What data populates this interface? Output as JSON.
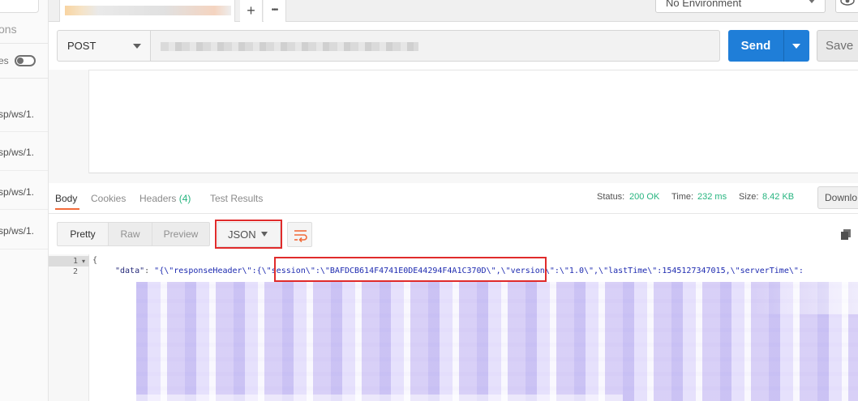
{
  "sidebar": {
    "tab_partial": "ons",
    "toggle_partial": "es",
    "items": [
      {
        "text": "sp/ws/1."
      },
      {
        "text": "sp/ws/1."
      },
      {
        "text": "sp/ws/1."
      },
      {
        "text": "sp/ws/1."
      }
    ]
  },
  "tabs": {
    "add_label": "+",
    "more_label": "•••"
  },
  "environment": {
    "selected": "No Environment",
    "eye_icon": "eye-icon"
  },
  "request": {
    "method": "POST",
    "send_label": "Send",
    "save_label": "Save"
  },
  "response": {
    "tabs": [
      {
        "label": "Body"
      },
      {
        "label": "Cookies"
      },
      {
        "label": "Headers",
        "count": "(4)"
      },
      {
        "label": "Test Results"
      }
    ],
    "status_label": "Status:",
    "status_value": "200 OK",
    "time_label": "Time:",
    "time_value": "232 ms",
    "size_label": "Size:",
    "size_value": "8.42 KB",
    "download_label": "Downlo",
    "view_modes": [
      "Pretty",
      "Raw",
      "Preview"
    ],
    "format": "JSON",
    "code": {
      "line1_num": "1",
      "line2_num": "2",
      "line1": "{",
      "key": "\"data\"",
      "colon": ": ",
      "part1": "\"{\\\"responseHeader\\\":{",
      "session": "\\\"session\\\":\\\"BAFDCB614F4741E0DE44294F4A1C370D\\\",",
      "part2": "\\\"version\\\":\\\"1.0\\\",\\\"lastTime\\\":1545127347015,\\\"serverTime\\\":"
    }
  },
  "colors": {
    "send": "#1f7ed8",
    "status_green": "#26b47f",
    "active_tab_underline": "#f26b3a",
    "highlight_red": "#e02b2b"
  }
}
